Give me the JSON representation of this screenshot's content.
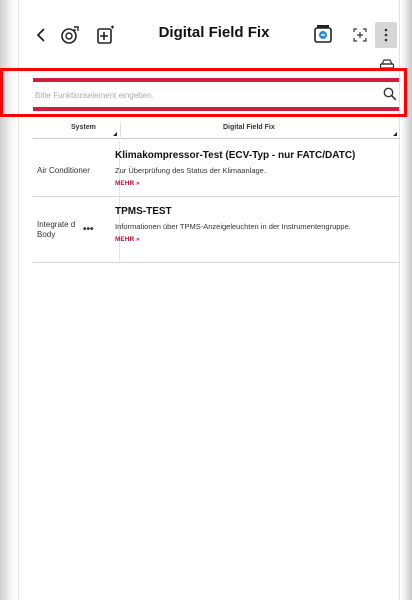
{
  "header": {
    "title": "Digital Field Fix",
    "icons": [
      "back-arrow-icon",
      "diagnostic-device-icon",
      "add-device-icon",
      "vehicle-data-icon",
      "scan-icon",
      "more-vertical-icon"
    ]
  },
  "search": {
    "placeholder": "Bitte Funktionselement eingeben.",
    "value": ""
  },
  "colors": {
    "accent": "#d31d3a",
    "more_link": "#c0123b",
    "highlight": "#ff0000"
  },
  "table": {
    "columns": [
      "System",
      "Digital Field Fix"
    ],
    "rows": [
      {
        "system": "Air Conditioner",
        "title": "Klimakompressor-Test (ECV-Typ - nur FATC/DATC)",
        "description": "Zur Überprüfung des Status der Klimaanlage.",
        "more": "MEHR »"
      },
      {
        "system": "Integrate d Body",
        "title": "TPMS-TEST",
        "description": "Informationen über TPMS-Anzeigeleuchten in der Instrumentengruppe.",
        "more": "MEHR »"
      }
    ]
  }
}
